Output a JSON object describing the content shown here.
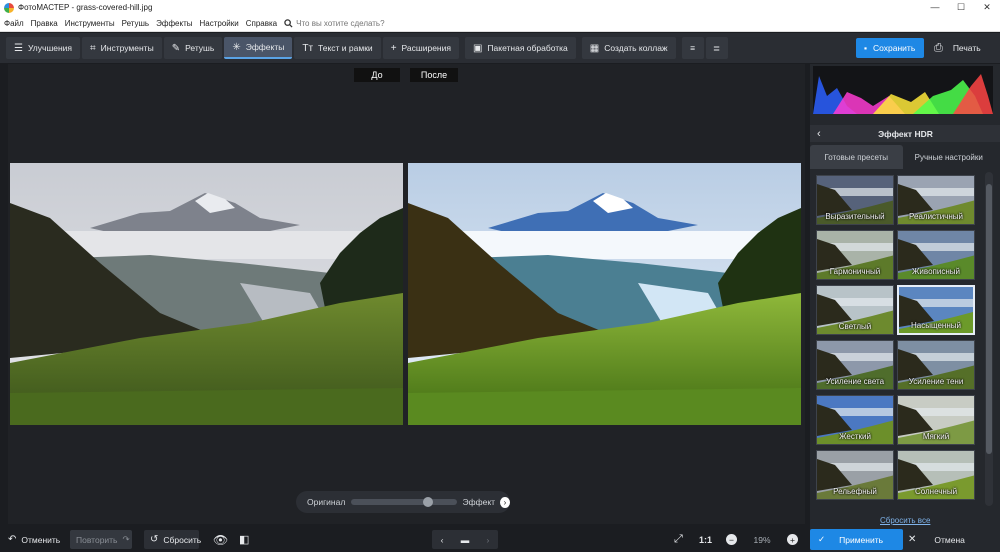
{
  "window": {
    "title": "ФотоМАСТЕР - grass-covered-hill.jpg",
    "minimize": "—",
    "maximize": "☐",
    "close": "✕"
  },
  "menu": {
    "items": [
      "Файл",
      "Правка",
      "Инструменты",
      "Ретушь",
      "Эффекты",
      "Настройки",
      "Справка"
    ],
    "search_placeholder": "Что вы хотите сделать?"
  },
  "toolbar": {
    "tabs": [
      {
        "label": "Улучшения",
        "icon": "sliders-icon",
        "glyph": "☰"
      },
      {
        "label": "Инструменты",
        "icon": "crop-icon",
        "glyph": "⌗"
      },
      {
        "label": "Ретушь",
        "icon": "brush-icon",
        "glyph": "✎"
      },
      {
        "label": "Эффекты",
        "icon": "magic-wand-icon",
        "glyph": "✳"
      },
      {
        "label": "Текст и рамки",
        "icon": "text-icon",
        "glyph": "Tт"
      },
      {
        "label": "Расширения",
        "icon": "plus-icon",
        "glyph": "+"
      }
    ],
    "active_tab": "Эффекты",
    "batch_label": "Пакетная обработка",
    "collage_label": "Создать коллаж",
    "save_label": "Сохранить",
    "print_label": "Печать"
  },
  "viewer": {
    "before_label": "До",
    "after_label": "После",
    "slider_left": "Оригинал",
    "slider_right": "Эффект",
    "slider_value": 0.73
  },
  "panel": {
    "histogram_colors": [
      "#2c5fff",
      "#ff3bd2",
      "#ffe83a",
      "#4dff4d",
      "#ff4444"
    ],
    "title": "Эффект HDR",
    "tab_presets": "Готовые пресеты",
    "tab_manual": "Ручные настройки",
    "presets": [
      "Выразительный",
      "Реалистичный",
      "Гармоничный",
      "Живописный",
      "Светлый",
      "Насыщенный",
      "Усиление света",
      "Усиление тени",
      "Жесткий",
      "Мягкий",
      "Рельефный",
      "Солнечный"
    ],
    "selected_preset": "Насыщенный",
    "reset_all": "Сбросить все",
    "apply_label": "Применить",
    "cancel_label": "Отмена"
  },
  "bottom": {
    "undo_label": "Отменить",
    "redo_label": "Повторить",
    "reset_label": "Сбросить",
    "ratio_label": "1:1",
    "zoom_value": "19%"
  },
  "colors": {
    "accent": "#1e88e5",
    "toolbar_bg": "#2a2d33",
    "panel_bg": "#25282d"
  }
}
